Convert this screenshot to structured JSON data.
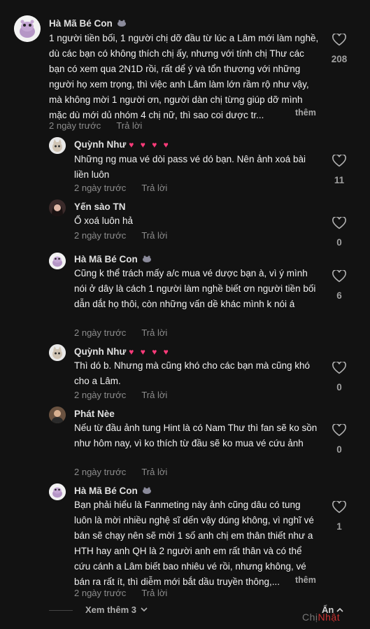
{
  "comments": [
    {
      "author": "Hà Mã Bé Con",
      "emojis": "",
      "text": "1 người tiền bối, 1 người chị dỡ đầu từ lúc a Lâm mới làm nghề, dù các bạn có không thích chị ấy, nhưng với tính chị Thư các bạn có xem qua 2N1D rồi, rất dể ý và tổn thương với những người họ xem trọng, thì việc anh Lâm làm lớn rầm rộ như vậy, mà không mời 1 người ơn, người dàn chị từng giúp dỡ mình mặc dù mới dủ nhóm 4 chị nữ, thì sao coi dược tr...",
      "more": "thêm",
      "time": "2 ngày trước",
      "reply": "Trả lời",
      "likes": "208"
    },
    {
      "author": "Quỳnh Như",
      "emojis": "♥ ♥ ♥ ♥",
      "text": "Những ng mua vé dòi pass vé dó bạn. Nên ảnh xoá bài liền luôn",
      "time": "2 ngày trước",
      "reply": "Trả lời",
      "likes": "11"
    },
    {
      "author": "Yến sào TN",
      "emojis": "",
      "text": "Ổ xoá luôn hả",
      "time": "2 ngày trước",
      "reply": "Trả lời",
      "likes": "0"
    },
    {
      "author": "Hà Mã Bé Con",
      "emojis": "",
      "text": "Cũng k thể trách mấy a/c mua vé dược bạn à, vì ý mình nói ở dây là cách 1 người làm nghề biết ơn người tiền bối dẫn dắt họ thôi, còn những vấn dề khác mình k nói á",
      "time": "2 ngày trước",
      "reply": "Trả lời",
      "likes": "6"
    },
    {
      "author": "Quỳnh Như",
      "emojis": "♥ ♥ ♥ ♥",
      "text": "Thì dó b. Nhưng mà cũng khó cho các bạn mà cũng khó cho a Lâm.",
      "time": "2 ngày trước",
      "reply": "Trả lời",
      "likes": "0"
    },
    {
      "author": "Phát Nèe",
      "emojis": "",
      "text": "Nếu từ đầu ảnh tung Hint là có Nam Thư thì fan sẽ ko sồn như hôm nay, vì ko thích từ đầu sẽ ko mua vé cứu ảnh",
      "time": "2 ngày trước",
      "reply": "Trả lời",
      "likes": "0"
    },
    {
      "author": "Hà Mã Bé Con",
      "emojis": "",
      "text": "Bạn phải hiểu là Fanmeting này ảnh cũng dâu có tung luôn là mời nhiều nghệ sĩ dến vậy dúng không, vì nghĩ vé bán sẽ chạy nên sẽ mời 1 số anh chị em thân thiết như a HTH hay anh QH là 2 người anh em rất thân và có thể cứu cánh a Lâm biết bao nhiêu vé rồi, nhưng không, vé bán ra rất ít, thì diễm mới bắt dầu truyền thông,...",
      "more": "thêm",
      "time": "2 ngày trước",
      "reply": "Trả lời",
      "likes": "1"
    }
  ],
  "footer": {
    "see_more": "Xem thêm 3",
    "hide": "Ẩn"
  },
  "watermark": {
    "part1": "Chị",
    "part2": "Nhật"
  },
  "colors": {
    "heart": "#ff3b7a",
    "background": "#121212"
  }
}
